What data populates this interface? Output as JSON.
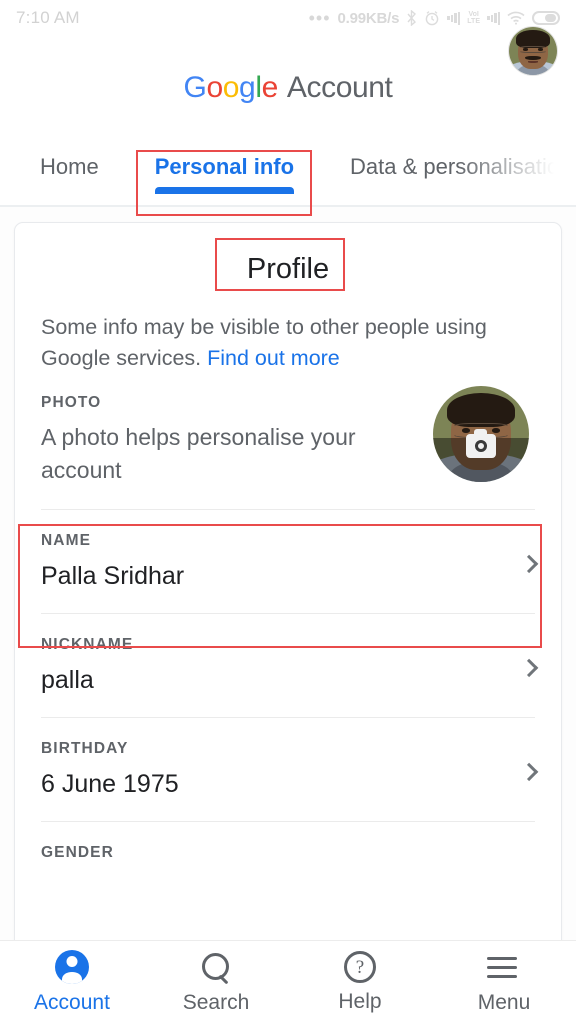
{
  "status_bar": {
    "time": "7:10 AM",
    "network_speed": "0.99KB/s",
    "icons": [
      "ellipsis-icon",
      "bluetooth-icon",
      "alarm-icon",
      "signal-bars-icon",
      "volte-icon",
      "signal-bars-icon",
      "wifi-icon",
      "battery-icon"
    ],
    "volte_top": "VoI",
    "volte_bottom": "LTE"
  },
  "header": {
    "logo_letters": [
      "G",
      "o",
      "o",
      "g",
      "l",
      "e"
    ],
    "brand_suffix": "Account",
    "avatar_name": "account-avatar"
  },
  "tabs": [
    {
      "label": "Home",
      "active": false
    },
    {
      "label": "Personal info",
      "active": true
    },
    {
      "label": "Data & personalisation",
      "active": false
    }
  ],
  "card": {
    "title": "Profile",
    "intro_text": "Some info may be visible to other people using Google services.",
    "intro_link": "Find out more",
    "rows": [
      {
        "label": "PHOTO",
        "sub": "A photo helps personalise your account",
        "value": "",
        "has_chevron": false,
        "has_avatar": true
      },
      {
        "label": "NAME",
        "value": "Palla Sridhar",
        "has_chevron": true
      },
      {
        "label": "NICKNAME",
        "value": "palla",
        "has_chevron": true
      },
      {
        "label": "BIRTHDAY",
        "value": "6 June 1975",
        "has_chevron": true
      },
      {
        "label": "GENDER",
        "value": "",
        "has_chevron": false
      }
    ]
  },
  "bottom_nav": [
    {
      "label": "Account",
      "icon": "person-circle-icon",
      "active": true
    },
    {
      "label": "Search",
      "icon": "search-icon",
      "active": false
    },
    {
      "label": "Help",
      "icon": "help-circle-icon",
      "active": false
    },
    {
      "label": "Menu",
      "icon": "hamburger-menu-icon",
      "active": false
    }
  ],
  "annotations": {
    "color": "#e94b4b",
    "boxes": [
      "personal-info-tab",
      "profile-title",
      "name-row"
    ]
  }
}
